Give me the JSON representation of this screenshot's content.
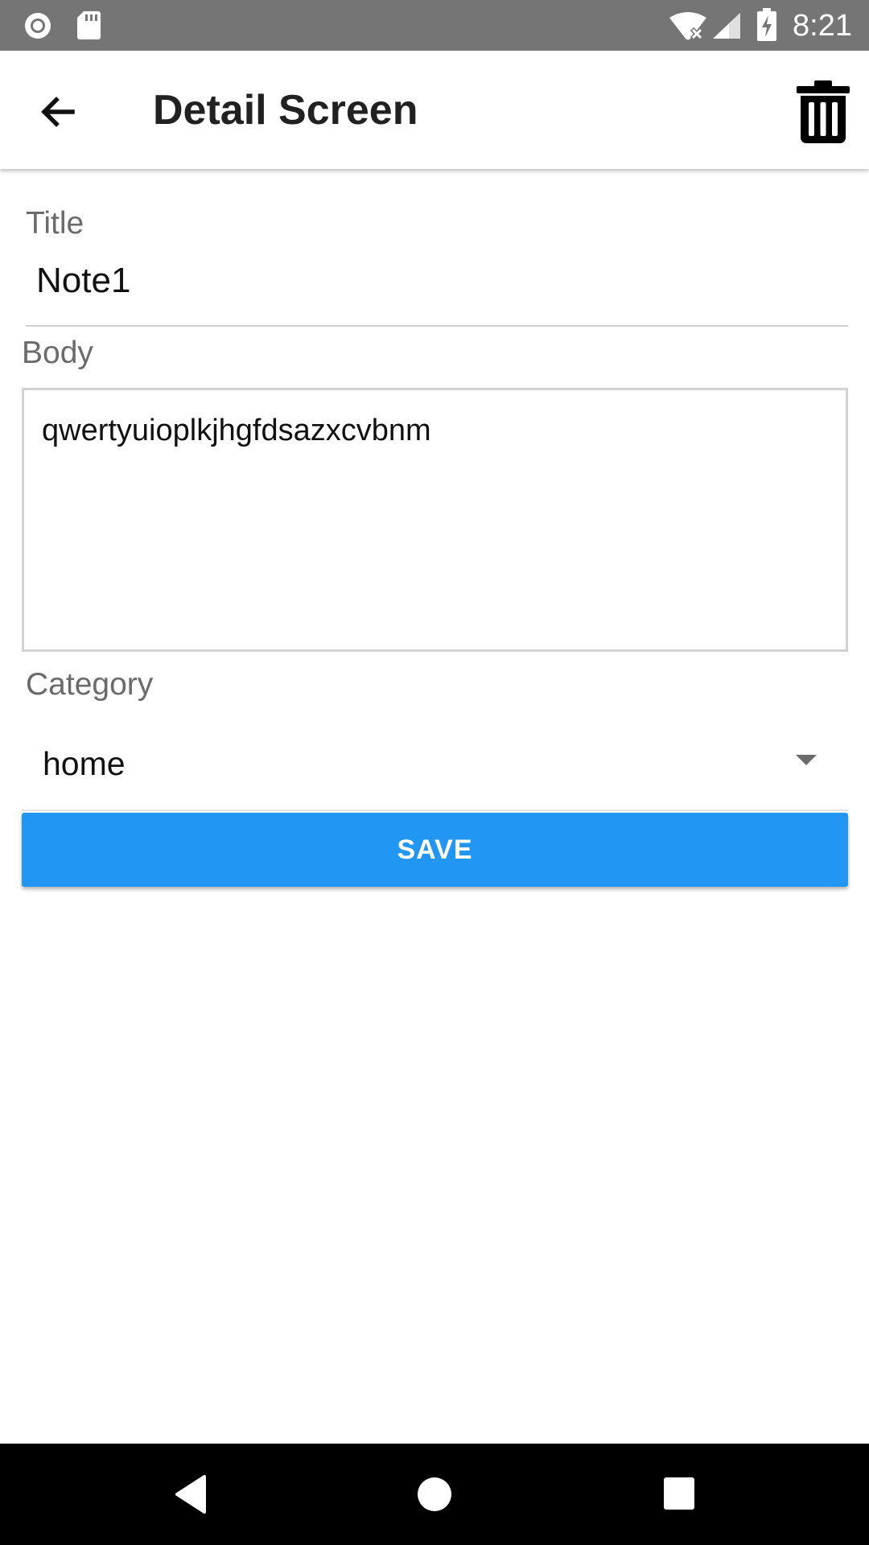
{
  "status_bar": {
    "time": "8:21",
    "icons": [
      "record-icon",
      "sd-card-icon",
      "wifi-off-icon",
      "signal-icon",
      "battery-charging-icon"
    ]
  },
  "app_bar": {
    "title": "Detail Screen",
    "back_icon": "arrow-back-icon",
    "delete_icon": "trash-icon"
  },
  "form": {
    "title_label": "Title",
    "title_value": "Note1",
    "body_label": "Body",
    "body_value": "qwertyuioplkjhgfdsazxcvbnm",
    "category_label": "Category",
    "category_value": "home",
    "save_label": "SAVE"
  },
  "colors": {
    "status_bar": "#757575",
    "accent": "#2196f3",
    "nav_bar": "#000000"
  },
  "nav_bar": {
    "icons": [
      "nav-back-icon",
      "nav-home-icon",
      "nav-recent-icon"
    ]
  }
}
